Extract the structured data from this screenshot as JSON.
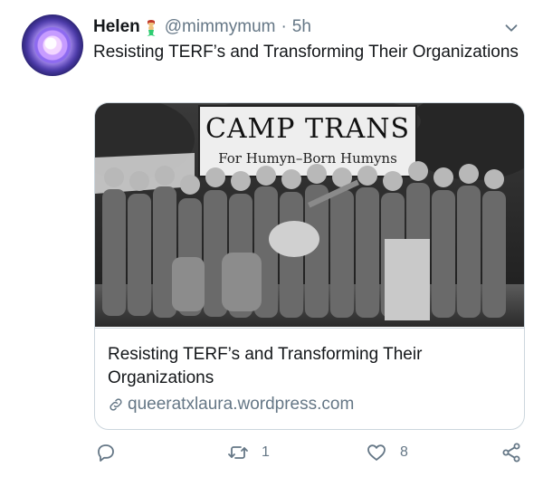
{
  "user": {
    "display_name": "Helen",
    "handle": "@mimmymum",
    "separator": "·",
    "time": "5h"
  },
  "tweet": {
    "text": "Resisting TERF’s and Transforming Their Organizations"
  },
  "card": {
    "image_banner_line1": "CAMP TRANS",
    "image_banner_line2": "For Humyn–Born Humyns",
    "title": "Resisting TERF’s and Transforming Their Organizations",
    "domain": "queeratxlaura.wordpress.com"
  },
  "actions": {
    "reply_count": "",
    "retweet_count": "1",
    "like_count": "8"
  },
  "colors": {
    "text_primary": "#14171a",
    "text_secondary": "#657786",
    "border": "#ccd6dd"
  },
  "icons": [
    "mermaid-emoji",
    "chevron-down-icon",
    "link-icon",
    "reply-icon",
    "retweet-icon",
    "like-icon",
    "share-icon"
  ]
}
